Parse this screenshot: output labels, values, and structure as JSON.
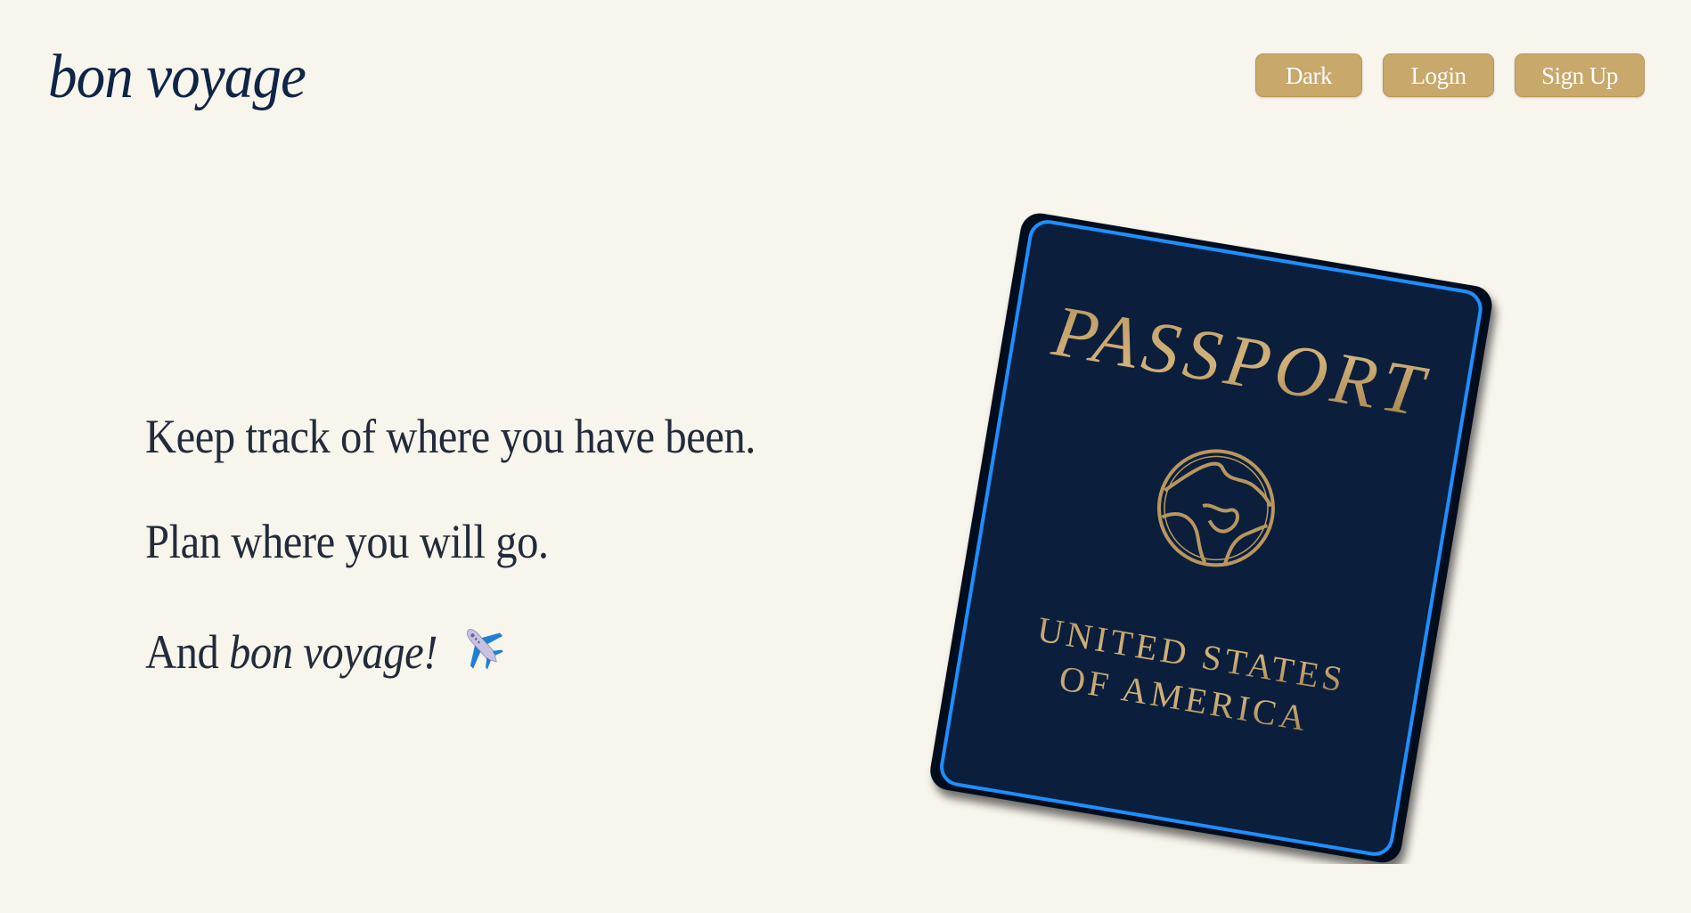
{
  "header": {
    "logo": "bon voyage",
    "nav": {
      "dark_label": "Dark",
      "login_label": "Login",
      "signup_label": "Sign Up"
    }
  },
  "hero": {
    "line1": "Keep track of where you have been.",
    "line2": "Plan where you will go.",
    "line3_prefix": "And ",
    "line3_emphasis": "bon voyage!",
    "line3_icon": "airplane-icon"
  },
  "passport": {
    "title": "PASSPORT",
    "country_line1": "UNITED STATES",
    "country_line2": "OF AMERICA",
    "emblem_icon": "globe-icon"
  },
  "colors": {
    "background": "#f8f5ed",
    "navy": "#0b1f3d",
    "gold": "#c8a86b",
    "accent_blue": "#1e8fff"
  }
}
